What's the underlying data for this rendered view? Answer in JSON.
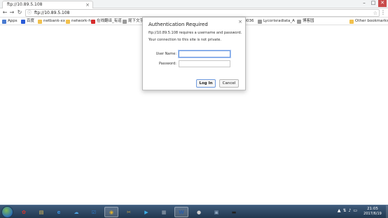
{
  "browser": {
    "tab_title": "ftp://10.89.5.108",
    "address": "ftp://10.89.5.108",
    "window_controls": [
      "–",
      "□",
      "✕"
    ]
  },
  "bookmarks": [
    {
      "label": "Apps",
      "icon": "apps-icon",
      "color": "#4a7bd0"
    },
    {
      "label": "百度",
      "icon": "baidu-icon",
      "color": "#2a5bd7"
    },
    {
      "label": "netbank-xx",
      "icon": "folder-icon",
      "color": "#f2c14e"
    },
    {
      "label": "network-h",
      "icon": "folder-icon",
      "color": "#f2c14e"
    },
    {
      "label": "在线翻译_有道",
      "icon": "youdao-icon",
      "color": "#d62c2c"
    },
    {
      "label": "尾下文字",
      "icon": "page-icon",
      "color": "#9a9a9a"
    },
    {
      "label": "38036",
      "icon": "page-icon",
      "color": "#9a9a9a"
    },
    {
      "label": "Lycorisradiata_A",
      "icon": "page-icon",
      "color": "#9a9a9a"
    },
    {
      "label": "博客园",
      "icon": "page-icon",
      "color": "#9a9a9a"
    },
    {
      "label": "Other bookmarks",
      "icon": "folder-icon",
      "color": "#f2c14e"
    }
  ],
  "dialog": {
    "title": "Authentication Required",
    "message1": "ftp://10.89.5.108 requires a username and password.",
    "message2": "Your connection to this site is not private.",
    "username_label": "User Name:",
    "username_value": "",
    "password_label": "Password:",
    "password_value": "",
    "login_label": "Log In",
    "cancel_label": "Cancel"
  },
  "taskbar": {
    "time": "21:05",
    "date": "2017/6/19",
    "apps": [
      {
        "name": "huawei-app-icon",
        "glyph": "✿",
        "color": "#d9342b"
      },
      {
        "name": "explorer-icon",
        "glyph": "▤",
        "color": "#e8c35a"
      },
      {
        "name": "ie-icon",
        "glyph": "e",
        "color": "#3a8fd9"
      },
      {
        "name": "cloud-icon",
        "glyph": "☁",
        "color": "#4fa3e0"
      },
      {
        "name": "checklist-icon",
        "glyph": "☑",
        "color": "#2d7fd3"
      },
      {
        "name": "chrome-icon",
        "glyph": "◉",
        "color": "#e0b02a"
      },
      {
        "name": "tools-icon",
        "glyph": "✂",
        "color": "#c9a440"
      },
      {
        "name": "media-player-icon",
        "glyph": "▶",
        "color": "#3fb0e8"
      },
      {
        "name": "calculator-icon",
        "glyph": "▦",
        "color": "#9aa7b5"
      },
      {
        "name": "word-icon",
        "glyph": "W",
        "color": "#2b5ca8"
      },
      {
        "name": "paint-icon",
        "glyph": "●",
        "color": "#cfcfcf"
      },
      {
        "name": "network-icon",
        "glyph": "▣",
        "color": "#8ea8c2"
      },
      {
        "name": "terminal-icon",
        "glyph": "▬",
        "color": "#222222"
      }
    ]
  }
}
